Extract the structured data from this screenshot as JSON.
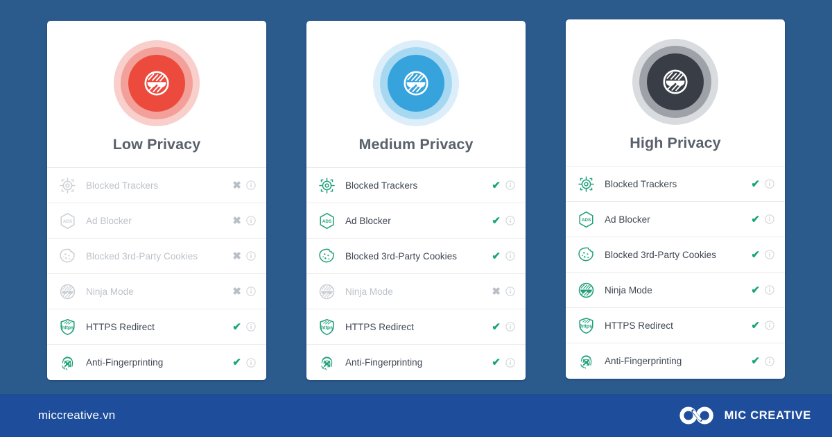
{
  "background_color": "#2b5a8c",
  "cards": [
    {
      "id": "low-privacy",
      "title": "Low Privacy",
      "badge": {
        "icon": "ninja-mask-icon",
        "core_color": "#eb4a3c",
        "mid_color": "#f2a099",
        "outer_color": "#f8cfcb"
      },
      "features": [
        {
          "icon": "target-icon",
          "label": "Blocked Trackers",
          "status": "off",
          "mark": "✖",
          "info": "info-icon"
        },
        {
          "icon": "ads-hexagon-icon",
          "label": "Ad Blocker",
          "status": "off",
          "mark": "✖",
          "info": "info-icon"
        },
        {
          "icon": "cookie-icon",
          "label": "Blocked 3rd-Party Cookies",
          "status": "off",
          "mark": "✖",
          "info": "info-icon"
        },
        {
          "icon": "ninja-mask-icon",
          "label": "Ninja Mode",
          "status": "off",
          "mark": "✖",
          "info": "info-icon"
        },
        {
          "icon": "https-shield-icon",
          "label": "HTTPS Redirect",
          "status": "on",
          "mark": "✔",
          "info": "info-icon"
        },
        {
          "icon": "fingerprint-icon",
          "label": "Anti-Fingerprinting",
          "status": "on",
          "mark": "✔",
          "info": "info-icon"
        }
      ]
    },
    {
      "id": "medium-privacy",
      "title": "Medium Privacy",
      "badge": {
        "icon": "ninja-mask-icon",
        "core_color": "#36a3dd",
        "mid_color": "#a7d8f2",
        "outer_color": "#dceefa"
      },
      "features": [
        {
          "icon": "target-icon",
          "label": "Blocked Trackers",
          "status": "on",
          "mark": "✔",
          "info": "info-icon"
        },
        {
          "icon": "ads-hexagon-icon",
          "label": "Ad Blocker",
          "status": "on",
          "mark": "✔",
          "info": "info-icon"
        },
        {
          "icon": "cookie-icon",
          "label": "Blocked 3rd-Party Cookies",
          "status": "on",
          "mark": "✔",
          "info": "info-icon"
        },
        {
          "icon": "ninja-mask-icon",
          "label": "Ninja Mode",
          "status": "off",
          "mark": "✖",
          "info": "info-icon"
        },
        {
          "icon": "https-shield-icon",
          "label": "HTTPS Redirect",
          "status": "on",
          "mark": "✔",
          "info": "info-icon"
        },
        {
          "icon": "fingerprint-icon",
          "label": "Anti-Fingerprinting",
          "status": "on",
          "mark": "✔",
          "info": "info-icon"
        }
      ]
    },
    {
      "id": "high-privacy",
      "title": "High Privacy",
      "badge": {
        "icon": "ninja-mask-icon",
        "core_color": "#3b3f४7",
        "core_color_hex": "#393d45",
        "mid_color": "#9ea2a8",
        "outer_color": "#d9dcdf"
      },
      "features": [
        {
          "icon": "target-icon",
          "label": "Blocked Trackers",
          "status": "on",
          "mark": "✔",
          "info": "info-icon"
        },
        {
          "icon": "ads-hexagon-icon",
          "label": "Ad Blocker",
          "status": "on",
          "mark": "✔",
          "info": "info-icon"
        },
        {
          "icon": "cookie-icon",
          "label": "Blocked 3rd-Party Cookies",
          "status": "on",
          "mark": "✔",
          "info": "info-icon"
        },
        {
          "icon": "ninja-mask-icon",
          "label": "Ninja Mode",
          "status": "on",
          "mark": "✔",
          "info": "info-icon"
        },
        {
          "icon": "https-shield-icon",
          "label": "HTTPS Redirect",
          "status": "on",
          "mark": "✔",
          "info": "info-icon"
        },
        {
          "icon": "fingerprint-icon",
          "label": "Anti-Fingerprinting",
          "status": "on",
          "mark": "✔",
          "info": "info-icon"
        }
      ]
    }
  ],
  "footer": {
    "url": "miccreative.vn",
    "brand_name": "MIC CREATIVE",
    "brand_mark_icon": "infinity-loop-icon",
    "background_color": "#1e4d9b"
  },
  "colors": {
    "enabled_icon": "#21a179",
    "disabled_icon": "#cbd0d5",
    "check": "#17a673",
    "cross": "#b9bfc6",
    "title_text": "#59616b",
    "label_text": "#3f4752",
    "label_text_disabled": "#bcc2c8"
  }
}
